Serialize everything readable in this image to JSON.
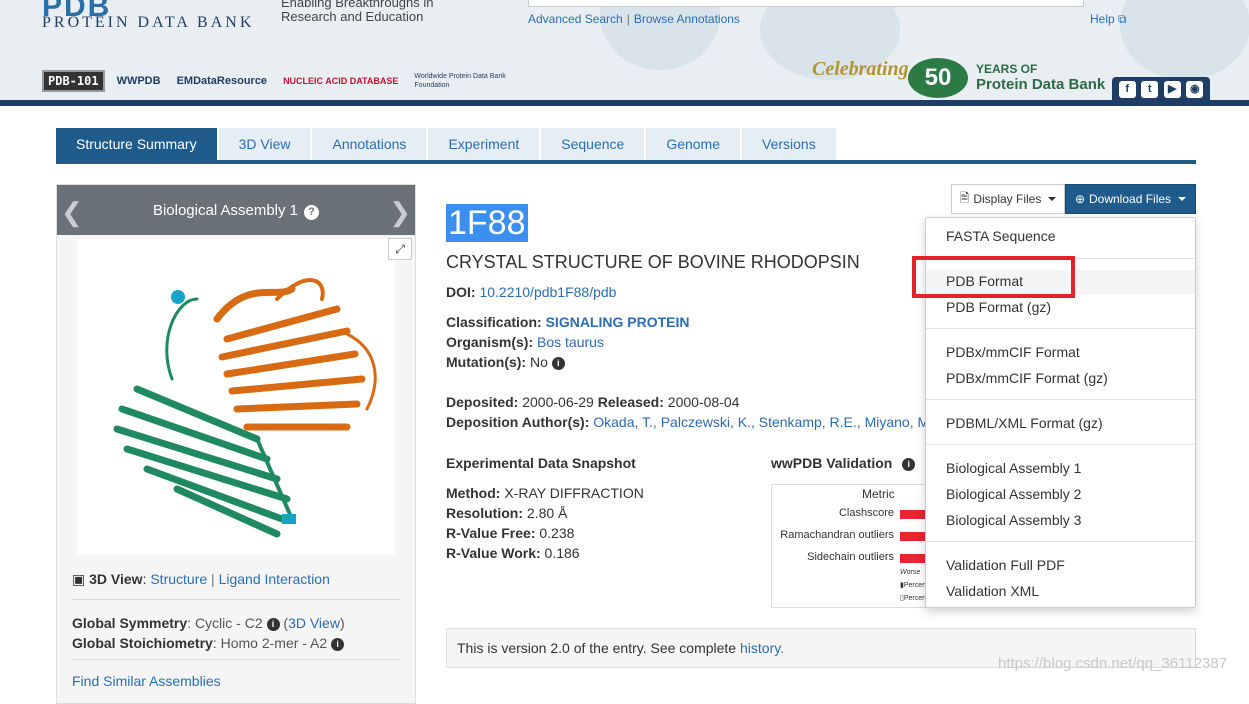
{
  "header": {
    "logo_top": "PDB",
    "logo_text": "PROTEIN DATA BANK",
    "tagline": [
      "Enabling Breakthroughs in",
      "Research and Education"
    ],
    "advanced_search": "Advanced Search",
    "separator": "|",
    "browse_annotations": "Browse Annotations",
    "help": "Help",
    "partners": [
      "PDB-101",
      "WWPDB",
      "EMDataResource",
      "NUCLEIC ACID DATABASE",
      "Worldwide Protein Data Bank Foundation"
    ],
    "celebrating": "Celebrating",
    "years_number": "50",
    "years_of": "YEARS OF",
    "years_bank": "Protein Data Bank",
    "social": [
      "f",
      "t",
      "▶",
      "◉"
    ]
  },
  "tabs": [
    "Structure Summary",
    "3D View",
    "Annotations",
    "Experiment",
    "Sequence",
    "Genome",
    "Versions"
  ],
  "left": {
    "assembly_title": "Biological Assembly 1",
    "help_glyph": "?",
    "view3d_label": "3D View",
    "view3d_structure": "Structure",
    "view3d_sep": "|",
    "view3d_ligand": "Ligand Interaction",
    "sym_label": "Global Symmetry",
    "sym_value": "Cyclic - C2",
    "sym_link": "3D View",
    "stoich_label": "Global Stoichiometry",
    "stoich_value": "Homo 2-mer - A2",
    "similar": "Find Similar Assemblies"
  },
  "entry": {
    "id": "1F88",
    "title": "CRYSTAL STRUCTURE OF BOVINE RHODOPSIN",
    "doi_label": "DOI:",
    "doi": "10.2210/pdb1F88/pdb",
    "classification_label": "Classification:",
    "classification": "SIGNALING PROTEIN",
    "organism_label": "Organism(s):",
    "organism": "Bos taurus",
    "mutation_label": "Mutation(s):",
    "mutation": "No",
    "deposited_label": "Deposited:",
    "deposited": "2000-06-29",
    "released_label": "Released:",
    "released": "2000-08-04",
    "authors_label": "Deposition Author(s):",
    "authors": [
      "Okada, T.,",
      "Palczewski, K.,",
      "Stenkamp, R.E.,",
      "Miyano, M"
    ],
    "snapshot_title": "Experimental Data Snapshot",
    "method_label": "Method:",
    "method": "X-RAY DIFFRACTION",
    "resolution_label": "Resolution:",
    "resolution": "2.80 Å",
    "rfree_label": "R-Value Free:",
    "rfree": "0.238",
    "rwork_label": "R-Value Work:",
    "rwork": "0.186",
    "wwpdb_title": "wwPDB Validation",
    "version_text": "This is version 2.0 of the entry. See complete ",
    "version_link": "history."
  },
  "validation": {
    "metric": "Metric",
    "rows": [
      "Clashscore",
      "Ramachandran outliers",
      "Sidechain outliers"
    ],
    "worse": "Worse",
    "legend": [
      "Percen",
      "Percen"
    ]
  },
  "buttons": {
    "display": "Display Files",
    "download": "Download Files"
  },
  "dropdown": {
    "items": [
      "FASTA Sequence",
      "PDB Format",
      "PDB Format (gz)",
      "PDBx/mmCIF Format",
      "PDBx/mmCIF Format (gz)",
      "PDBML/XML Format (gz)",
      "Biological Assembly 1",
      "Biological Assembly 2",
      "Biological Assembly 3",
      "Validation Full PDF",
      "Validation XML"
    ]
  },
  "watermark": "https://blog.csdn.net/qq_36112387",
  "colors": {
    "primary": "#1f5c8b",
    "link": "#2b6db5",
    "highlight": "#3b8ff0",
    "annotation_red": "#e3232a",
    "chain_a": "#d96a14",
    "chain_b": "#1f8a62"
  }
}
